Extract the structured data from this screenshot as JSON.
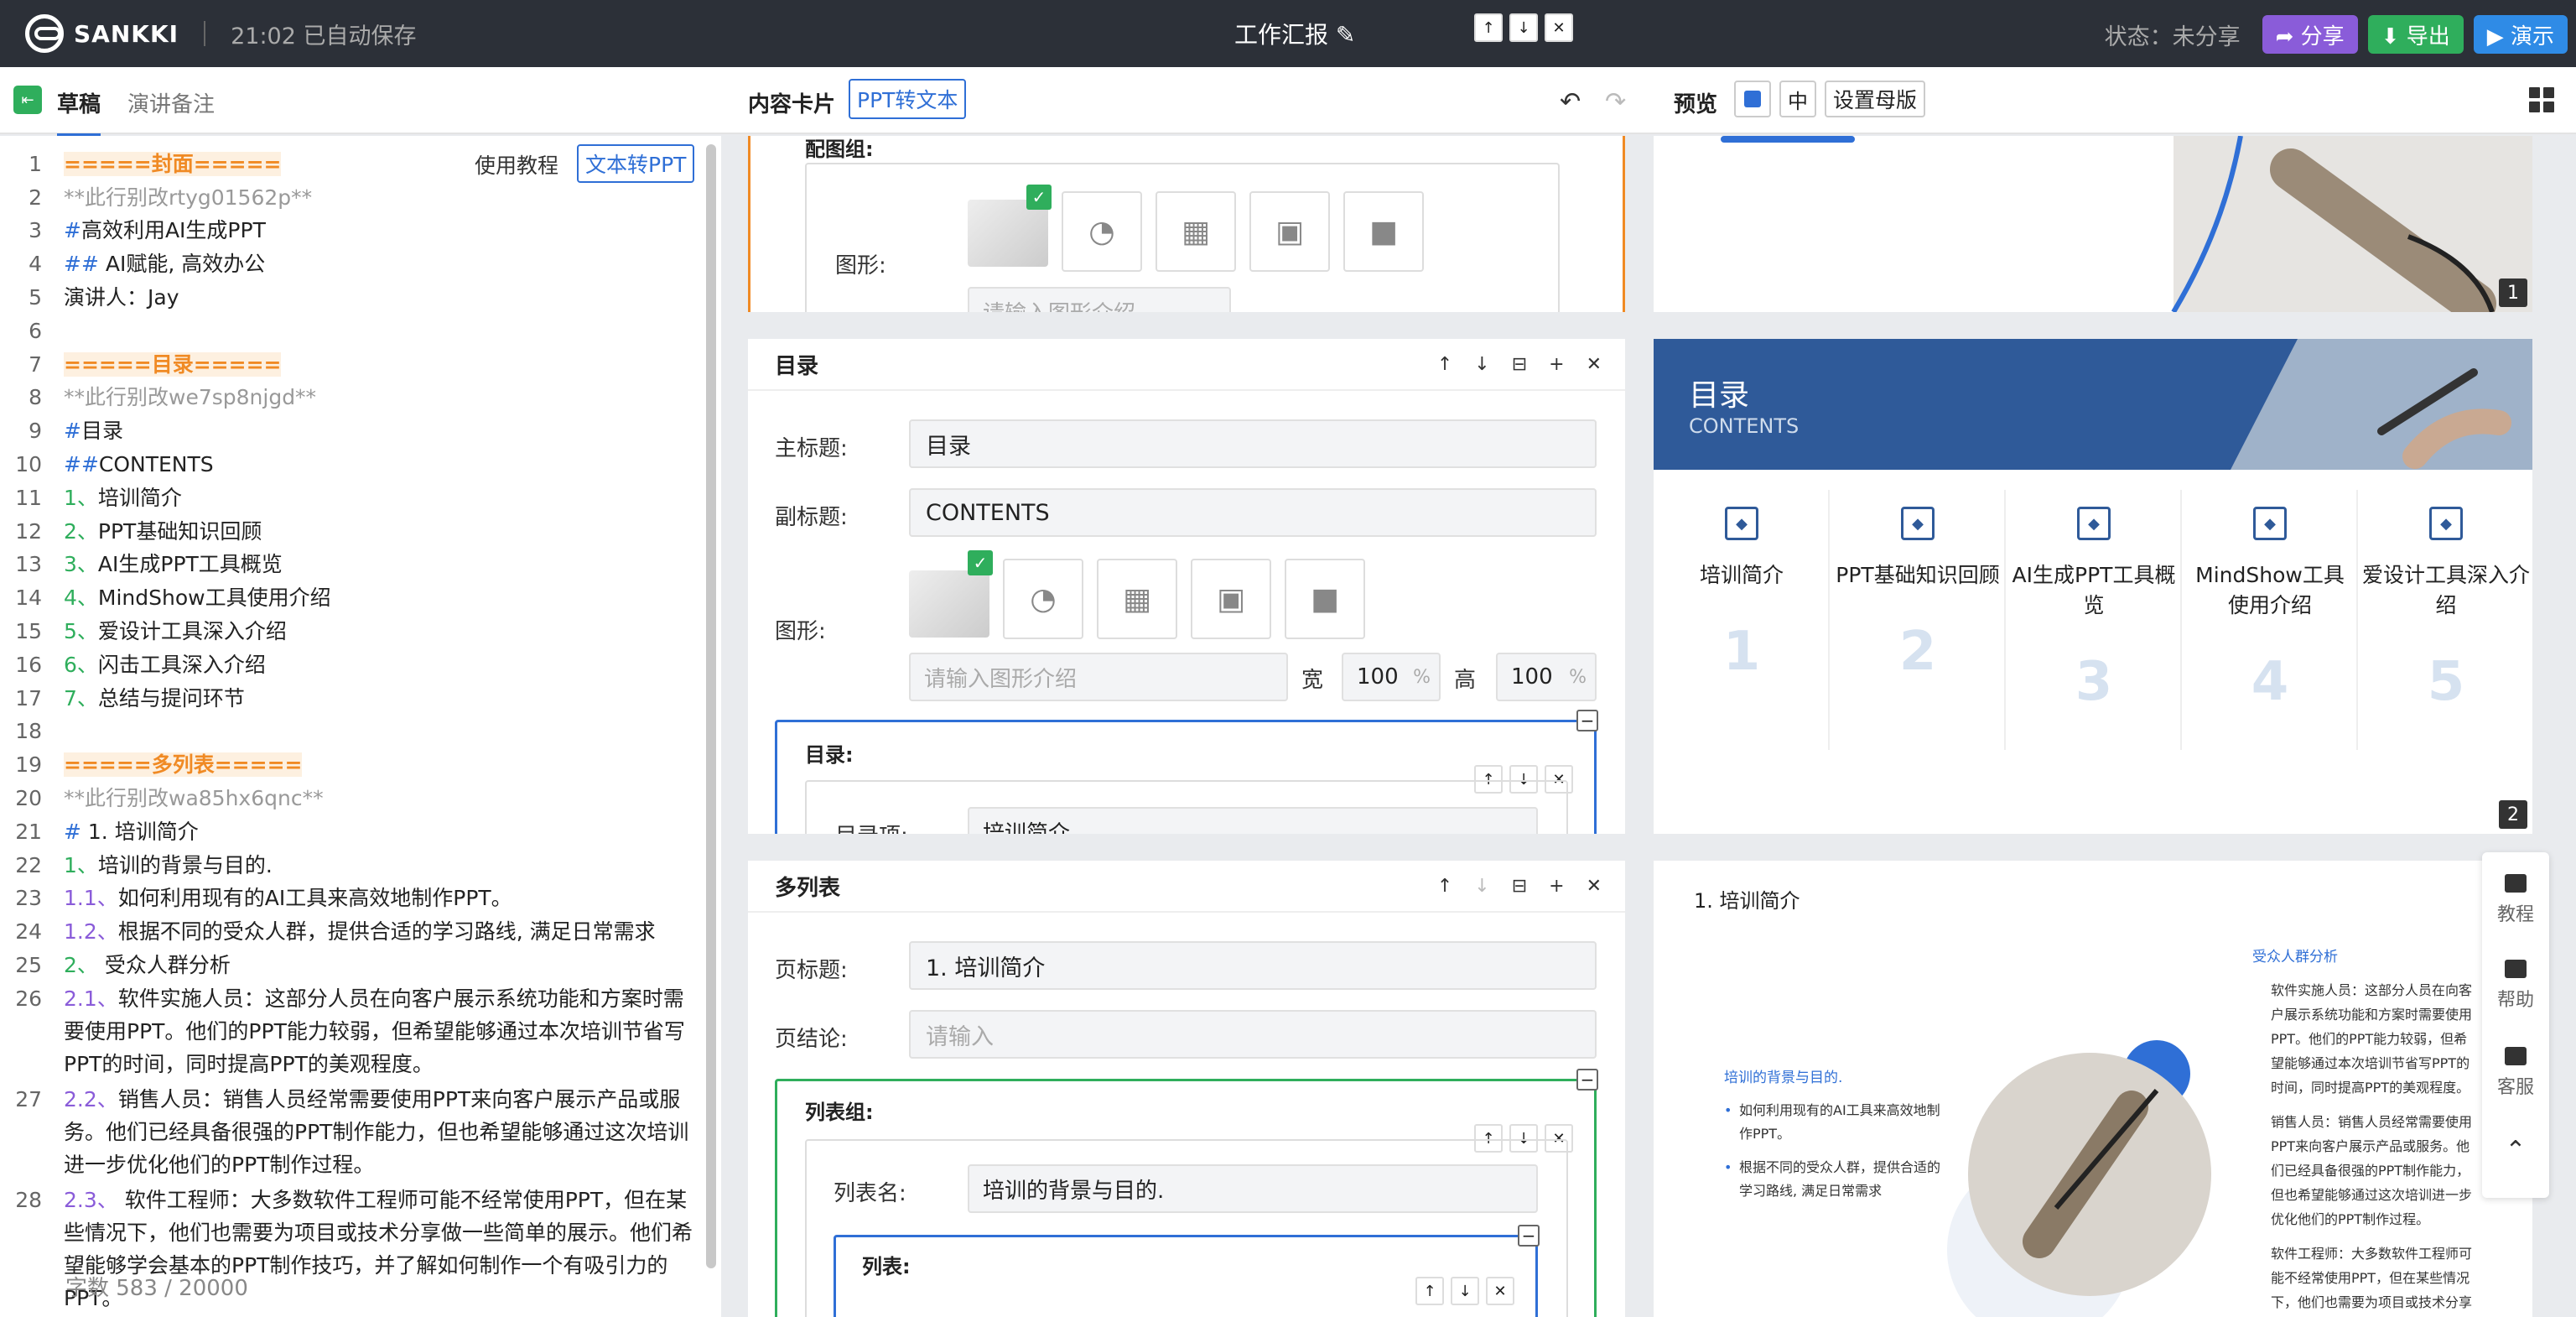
{
  "app": {
    "logo": "SANKKI",
    "autosave": "21:02 已自动保存",
    "title": "工作汇报 ✎",
    "status": "状态：未分享",
    "share": "➦ 分享",
    "export": "⬇ 导出",
    "present": "▶ 演示"
  },
  "toolbar": {
    "tab_draft": "草稿",
    "tab_notes": "演讲备注",
    "cards_title": "内容卡片",
    "ppt_to_text": "PPT转文本",
    "undo": "↶",
    "redo": "↷",
    "preview": "预览",
    "zh": "中",
    "master": "设置母版"
  },
  "editor": {
    "tutorial": "使用教程",
    "text_to_ppt": "文本转PPT",
    "word_count": "字数 583 / 20000",
    "lines": [
      {
        "n": "1",
        "segs": [
          {
            "c": "o",
            "t": "=====封面====="
          }
        ]
      },
      {
        "n": "2",
        "segs": [
          {
            "c": "g",
            "t": "**此行别改rtyg01562p**"
          }
        ]
      },
      {
        "n": "3",
        "segs": [
          {
            "c": "b",
            "t": "#"
          },
          {
            "c": "",
            "t": "高效利用AI生成PPT"
          }
        ]
      },
      {
        "n": "4",
        "segs": [
          {
            "c": "b",
            "t": "##"
          },
          {
            "c": "",
            "t": " AI赋能, 高效办公"
          }
        ]
      },
      {
        "n": "5",
        "segs": [
          {
            "c": "",
            "t": "演讲人：Jay"
          }
        ]
      },
      {
        "n": "6",
        "segs": [
          {
            "c": "",
            "t": ""
          }
        ]
      },
      {
        "n": "7",
        "segs": [
          {
            "c": "o",
            "t": "=====目录====="
          }
        ]
      },
      {
        "n": "8",
        "segs": [
          {
            "c": "g",
            "t": "**此行别改we7sp8njgd**"
          }
        ]
      },
      {
        "n": "9",
        "segs": [
          {
            "c": "b",
            "t": "#"
          },
          {
            "c": "",
            "t": "目录"
          }
        ]
      },
      {
        "n": "10",
        "segs": [
          {
            "c": "b",
            "t": "##"
          },
          {
            "c": "",
            "t": "CONTENTS"
          }
        ]
      },
      {
        "n": "11",
        "segs": [
          {
            "c": "gr",
            "t": "1、"
          },
          {
            "c": "",
            "t": "培训简介"
          }
        ]
      },
      {
        "n": "12",
        "segs": [
          {
            "c": "gr",
            "t": "2、"
          },
          {
            "c": "",
            "t": "PPT基础知识回顾"
          }
        ]
      },
      {
        "n": "13",
        "segs": [
          {
            "c": "gr",
            "t": "3、"
          },
          {
            "c": "",
            "t": "AI生成PPT工具概览"
          }
        ]
      },
      {
        "n": "14",
        "segs": [
          {
            "c": "gr",
            "t": "4、"
          },
          {
            "c": "",
            "t": "MindShow工具使用介绍"
          }
        ]
      },
      {
        "n": "15",
        "segs": [
          {
            "c": "gr",
            "t": "5、"
          },
          {
            "c": "",
            "t": "爱设计工具深入介绍"
          }
        ]
      },
      {
        "n": "16",
        "segs": [
          {
            "c": "gr",
            "t": "6、"
          },
          {
            "c": "",
            "t": "闪击工具深入介绍"
          }
        ]
      },
      {
        "n": "17",
        "segs": [
          {
            "c": "gr",
            "t": "7、"
          },
          {
            "c": "",
            "t": "总结与提问环节"
          }
        ]
      },
      {
        "n": "18",
        "segs": [
          {
            "c": "",
            "t": ""
          }
        ]
      },
      {
        "n": "19",
        "segs": [
          {
            "c": "o",
            "t": "=====多列表====="
          }
        ]
      },
      {
        "n": "20",
        "segs": [
          {
            "c": "g",
            "t": "**此行别改wa85hx6qnc**"
          }
        ]
      },
      {
        "n": "21",
        "segs": [
          {
            "c": "b",
            "t": "#"
          },
          {
            "c": "",
            "t": " 1. 培训简介"
          }
        ]
      },
      {
        "n": "22",
        "segs": [
          {
            "c": "gr",
            "t": "1、"
          },
          {
            "c": "",
            "t": "培训的背景与目的."
          }
        ]
      },
      {
        "n": "23",
        "segs": [
          {
            "c": "p",
            "t": "1.1、"
          },
          {
            "c": "",
            "t": "如何利用现有的AI工具来高效地制作PPT。"
          }
        ]
      },
      {
        "n": "24",
        "segs": [
          {
            "c": "p",
            "t": "1.2、"
          },
          {
            "c": "",
            "t": "根据不同的受众人群，提供合适的学习路线, 满足日常需求"
          }
        ]
      },
      {
        "n": "25",
        "segs": [
          {
            "c": "gr",
            "t": "2、"
          },
          {
            "c": "",
            "t": " 受众人群分析"
          }
        ]
      },
      {
        "n": "26",
        "segs": [
          {
            "c": "p",
            "t": "2.1、"
          },
          {
            "c": "",
            "t": "软件实施人员：这部分人员在向客户展示系统功能和方案时需要使用PPT。他们的PPT能力较弱，但希望能够通过本次培训节省写PPT的时间，同时提高PPT的美观程度。"
          }
        ]
      },
      {
        "n": "27",
        "segs": [
          {
            "c": "p",
            "t": "2.2、"
          },
          {
            "c": "",
            "t": "销售人员：销售人员经常需要使用PPT来向客户展示产品或服务。他们已经具备很强的PPT制作能力，但也希望能够通过这次培训进一步优化他们的PPT制作过程。"
          }
        ]
      },
      {
        "n": "28",
        "segs": [
          {
            "c": "p",
            "t": "2.3、"
          },
          {
            "c": "",
            "t": " 软件工程师：大多数软件工程师可能不经常使用PPT，但在某些情况下，他们也需要为项目或技术分享做一些简单的展示。他们希望能够学会基本的PPT制作技巧，并了解如何制作一个有吸引力的PPT。"
          }
        ]
      }
    ]
  },
  "cards": {
    "cover_partial": {
      "group_title": "配图组:",
      "shape_label": "图形:",
      "desc_ph": "请输入图形介绍",
      "w_label": "宽",
      "w": "100",
      "h_label": "高",
      "h": "100",
      "pct": "%"
    },
    "toc": {
      "title": "目录",
      "main_label": "主标题:",
      "main": "目录",
      "sub_label": "副标题:",
      "sub": "CONTENTS",
      "shape_label": "图形:",
      "desc_ph": "请输入图形介绍",
      "w_label": "宽",
      "w": "100",
      "h_label": "高",
      "h": "100",
      "pct": "%",
      "group_title": "目录:",
      "item_label": "目录项:",
      "item": "培训简介"
    },
    "multi": {
      "title": "多列表",
      "page_title_label": "页标题:",
      "page_title": "1. 培训简介",
      "conclusion_label": "页结论:",
      "conclusion_ph": "请输入",
      "group_title": "列表组:",
      "list_name_label": "列表名:",
      "list_name": "培训的背景与目的.",
      "list_title": "列表:"
    }
  },
  "slides": {
    "s1": {
      "num": "1"
    },
    "s2": {
      "title": "目录",
      "subtitle": "CONTENTS",
      "num": "2",
      "items": [
        {
          "label": "培训简介",
          "num": "1"
        },
        {
          "label": "PPT基础知识回顾",
          "num": "2"
        },
        {
          "label": "AI生成PPT工具概览",
          "num": "3"
        },
        {
          "label": "MindShow工具使用介绍",
          "num": "4"
        },
        {
          "label": "爱设计工具深入介绍",
          "num": "5"
        }
      ]
    },
    "s3": {
      "title": "1. 培训简介",
      "left_heading": "培训的背景与目的.",
      "left_items": [
        "如何利用现有的AI工具来高效地制作PPT。",
        "根据不同的受众人群，提供合适的学习路线, 满足日常需求"
      ],
      "right_heading": "受众人群分析",
      "right_items": [
        "软件实施人员：这部分人员在向客户展示系统功能和方案时需要使用PPT。他们的PPT能力较弱，但希望能够通过本次培训节省写PPT的时间，同时提高PPT的美观程度。",
        "销售人员：销售人员经常需要使用PPT来向客户展示产品或服务。他们已经具备很强的PPT制作能力，但也希望能够通过这次培训进一步优化他们的PPT制作过程。",
        "软件工程师：大多数软件工程师可能不经常使用PPT，但在某些情况下，他们也需要为项目或技术分享做一些简单的展示。"
      ]
    }
  },
  "side_buttons": [
    {
      "label": "教程",
      "icon": "video-icon"
    },
    {
      "label": "帮助",
      "icon": "doc-icon"
    },
    {
      "label": "客服",
      "icon": "question-icon"
    }
  ]
}
